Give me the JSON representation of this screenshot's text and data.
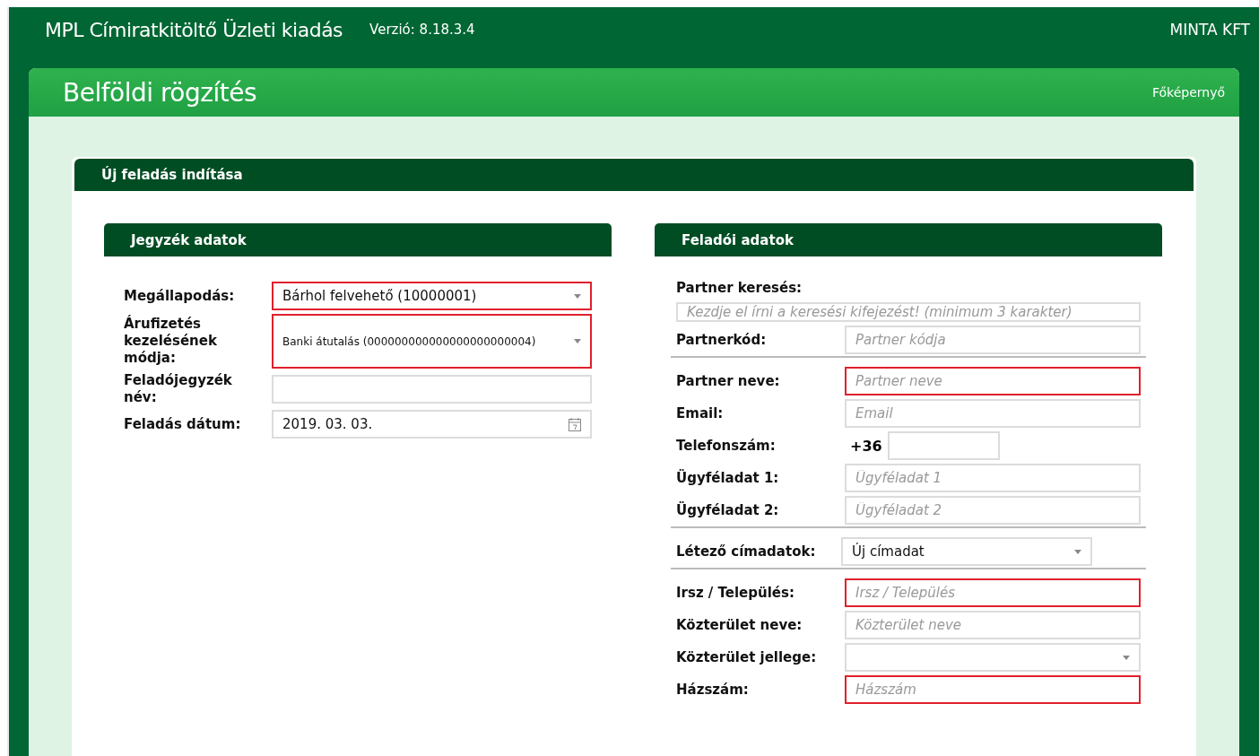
{
  "app": {
    "title": "MPL Címiratkitöltő Üzleti kiadás",
    "version": "Verzió: 8.18.3.4",
    "company": "MINTA KFT"
  },
  "page": {
    "title": "Belföldi rögzítés",
    "home_link": "Főképernyő"
  },
  "card": {
    "title": "Új feladás indítása"
  },
  "sections": [
    {
      "title": "Jegyzék adatok",
      "fields": [
        {
          "kind": "select",
          "label": "Megállapodás:",
          "value": "Bárhol felvehető (10000001)",
          "required": true,
          "divider_after": false
        },
        {
          "kind": "select-small",
          "label": "Árufizetés kezelésének módja:",
          "value": "Banki átutalás (000000000000000000000004)",
          "required": true,
          "divider_after": false
        },
        {
          "kind": "text",
          "label": "Feladójegyzék név:",
          "required": false,
          "divider_after": false
        },
        {
          "kind": "date",
          "label": "Feladás dátum:",
          "value": "2019. 03. 03.",
          "required": false,
          "divider_after": false
        }
      ]
    },
    {
      "title": "Feladói adatok",
      "fields": [
        {
          "kind": "search",
          "label": "Partner keresés:",
          "placeholder": "Kezdje el írni a keresési kifejezést! (minimum 3 karakter)",
          "required": false,
          "divider_after": false
        },
        {
          "kind": "text",
          "label": "Partnerkód:",
          "placeholder": "Partner kódja",
          "required": false,
          "divider_after": true
        },
        {
          "kind": "text",
          "label": "Partner neve:",
          "placeholder": "Partner neve",
          "required": true,
          "divider_after": false
        },
        {
          "kind": "text",
          "label": "Email:",
          "placeholder": "Email",
          "required": false,
          "divider_after": false
        },
        {
          "kind": "phone",
          "label": "Telefonszám:",
          "prefix": "+36",
          "required": false,
          "divider_after": false
        },
        {
          "kind": "text",
          "label": "Ügyféladat 1:",
          "placeholder": "Ügyféladat 1",
          "required": false,
          "divider_after": false
        },
        {
          "kind": "text",
          "label": "Ügyféladat 2:",
          "placeholder": "Ügyféladat 2",
          "required": false,
          "divider_after": true
        },
        {
          "kind": "select-narrow",
          "label": "Létező címadatok:",
          "value": "Új címadat",
          "required": false,
          "divider_after": true
        },
        {
          "kind": "text",
          "label": "Irsz / Település:",
          "placeholder": "Irsz / Település",
          "required": true,
          "divider_after": false
        },
        {
          "kind": "text",
          "label": "Közterület neve:",
          "placeholder": "Közterület neve",
          "required": false,
          "divider_after": false
        },
        {
          "kind": "select",
          "label": "Közterület jellege:",
          "required": false,
          "divider_after": false
        },
        {
          "kind": "text",
          "label": "Házszám:",
          "placeholder": "Házszám",
          "required": true,
          "divider_after": false
        }
      ]
    }
  ]
}
